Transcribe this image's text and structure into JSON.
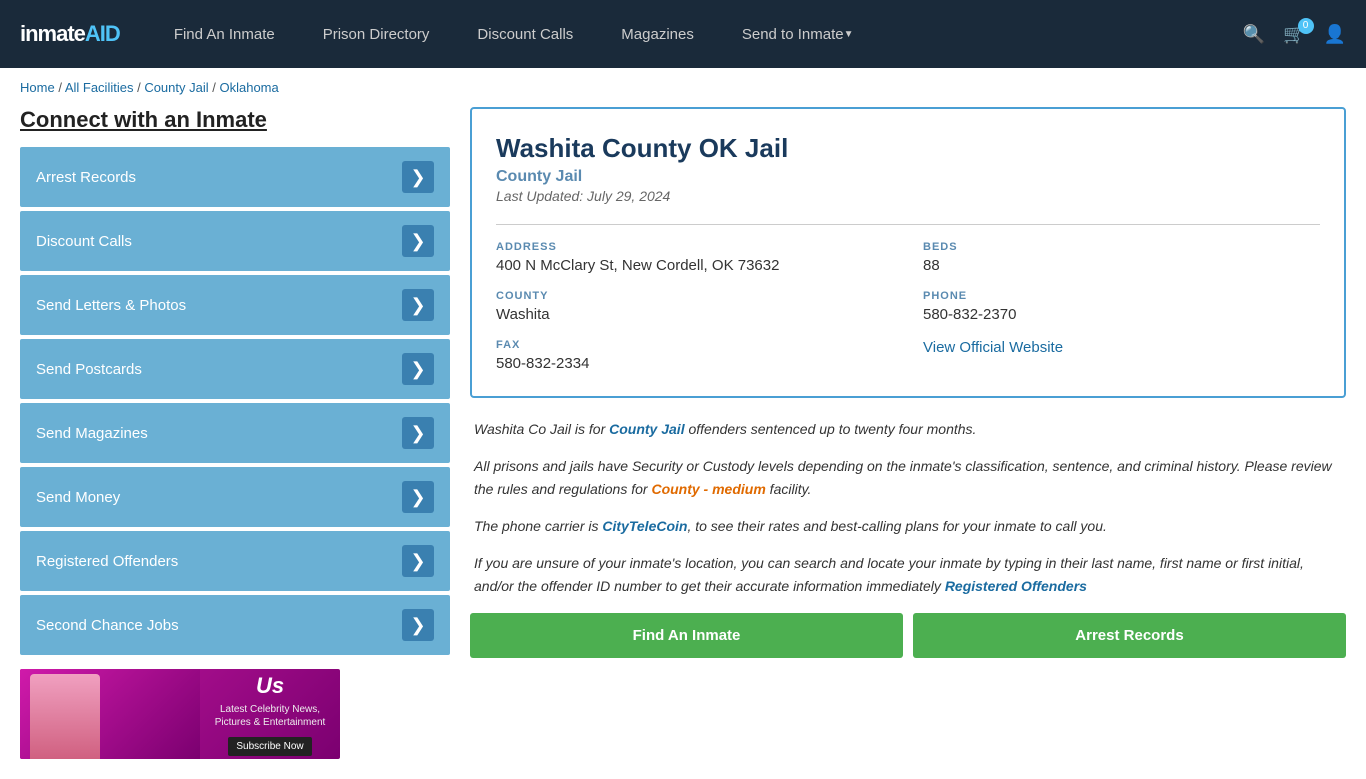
{
  "header": {
    "logo": "inmateAID",
    "logo_colored": "AID",
    "nav": [
      {
        "label": "Find An Inmate",
        "id": "find-inmate"
      },
      {
        "label": "Prison Directory",
        "id": "prison-directory"
      },
      {
        "label": "Discount Calls",
        "id": "discount-calls"
      },
      {
        "label": "Magazines",
        "id": "magazines"
      },
      {
        "label": "Send to Inmate",
        "id": "send-to-inmate",
        "dropdown": true
      }
    ],
    "cart_count": "0"
  },
  "breadcrumb": {
    "home": "Home",
    "all_facilities": "All Facilities",
    "county_jail": "County Jail",
    "state": "Oklahoma",
    "separator": "/"
  },
  "sidebar": {
    "title": "Connect with an Inmate",
    "menu_items": [
      {
        "label": "Arrest Records",
        "id": "arrest-records"
      },
      {
        "label": "Discount Calls",
        "id": "discount-calls"
      },
      {
        "label": "Send Letters & Photos",
        "id": "send-letters"
      },
      {
        "label": "Send Postcards",
        "id": "send-postcards"
      },
      {
        "label": "Send Magazines",
        "id": "send-magazines"
      },
      {
        "label": "Send Money",
        "id": "send-money"
      },
      {
        "label": "Registered Offenders",
        "id": "registered-offenders"
      },
      {
        "label": "Second Chance Jobs",
        "id": "second-chance-jobs"
      }
    ]
  },
  "ad": {
    "brand": "Us",
    "tagline": "Latest Celebrity News, Pictures & Entertainment",
    "cta": "Subscribe Now"
  },
  "facility": {
    "name": "Washita County OK Jail",
    "type": "County Jail",
    "last_updated": "Last Updated: July 29, 2024",
    "address_label": "ADDRESS",
    "address": "400 N McClary St, New Cordell, OK 73632",
    "beds_label": "BEDS",
    "beds": "88",
    "county_label": "COUNTY",
    "county": "Washita",
    "phone_label": "PHONE",
    "phone": "580-832-2370",
    "fax_label": "FAX",
    "fax": "580-832-2334",
    "website_label": "View Official Website",
    "website_url": "#"
  },
  "description": {
    "para1_pre": "Washita Co Jail is for ",
    "para1_link": "County Jail",
    "para1_post": " offenders sentenced up to twenty four months.",
    "para2_pre": "All prisons and jails have Security or Custody levels depending on the inmate's classification, sentence, and criminal history. Please review the rules and regulations for ",
    "para2_link": "County - medium",
    "para2_post": " facility.",
    "para3_pre": "The phone carrier is ",
    "para3_link": "CityTeleCoin",
    "para3_post": ", to see their rates and best-calling plans for your inmate to call you.",
    "para4_pre": "If you are unsure of your inmate's location, you can search and locate your inmate by typing in their last name, first name or first initial, and/or the offender ID number to get their accurate information immediately ",
    "para4_link": "Registered Offenders"
  },
  "buttons": [
    {
      "label": "Find An Inmate",
      "id": "btn-find-inmate"
    },
    {
      "label": "Arrest Records",
      "id": "btn-arrest-records"
    }
  ]
}
